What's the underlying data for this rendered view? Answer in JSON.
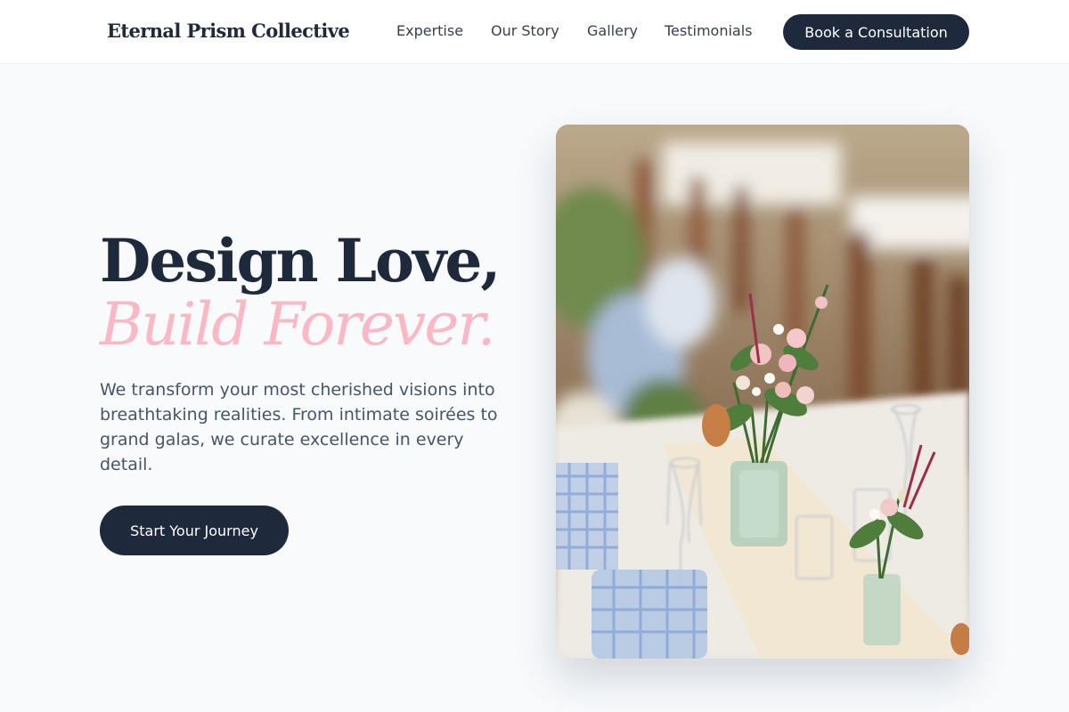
{
  "header": {
    "logo": "Eternal Prism Collective",
    "nav": [
      "Expertise",
      "Our Story",
      "Gallery",
      "Testimonials"
    ],
    "cta": "Book a Consultation"
  },
  "hero": {
    "headline_line1": "Design Love,",
    "headline_line2": "Build Forever.",
    "subtext": "We transform your most cherished visions into breathtaking realities. From intimate soirées to grand galas, we curate excellence in every detail.",
    "cta": "Start Your Journey",
    "image_subject": "wedding-table-floral-centerpiece"
  },
  "colors": {
    "primary": "#1e293b",
    "accent_pink": "#f9b8c4",
    "background": "#f8fafc",
    "body_text": "#475569"
  }
}
